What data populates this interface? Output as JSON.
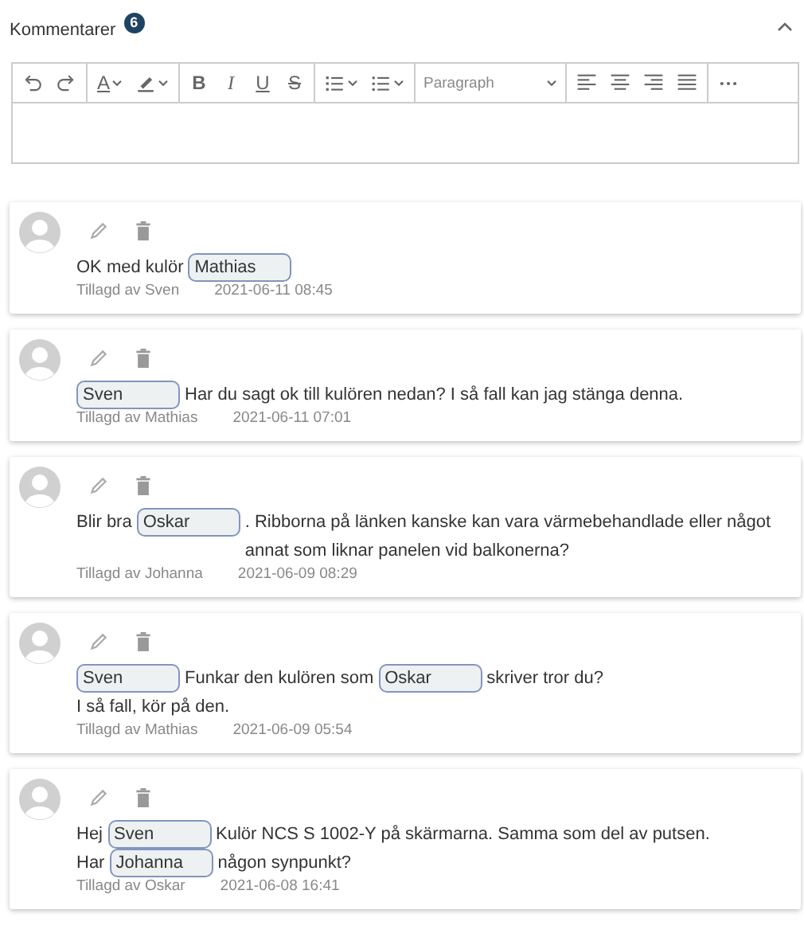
{
  "section": {
    "title": "Kommentarer",
    "count": "6",
    "expanded": true
  },
  "toolbar": {
    "groups": [
      [
        {
          "kind": "undo"
        },
        {
          "kind": "redo"
        }
      ],
      [
        {
          "kind": "font-color",
          "text": "A"
        },
        {
          "kind": "highlight"
        }
      ],
      [
        {
          "kind": "bold",
          "text": "B"
        },
        {
          "kind": "italic",
          "text": "I"
        },
        {
          "kind": "underline",
          "text": "U"
        },
        {
          "kind": "strike",
          "text": "S"
        }
      ],
      [
        {
          "kind": "ordered-list"
        },
        {
          "kind": "bullet-list"
        }
      ],
      [
        {
          "kind": "block-format",
          "text": "Paragraph"
        }
      ],
      [
        {
          "kind": "align-left"
        },
        {
          "kind": "align-center"
        },
        {
          "kind": "align-right"
        },
        {
          "kind": "align-justify"
        }
      ],
      [
        {
          "kind": "more"
        }
      ]
    ]
  },
  "comments": [
    {
      "author": "Tillagd av Sven",
      "date": "2021-06-11 08:45",
      "lines": [
        [
          {
            "kind": "text",
            "text": "OK med kulör"
          },
          {
            "kind": "mention",
            "text": "Mathias"
          }
        ]
      ]
    },
    {
      "author": "Tillagd av Mathias",
      "date": "2021-06-11 07:01",
      "lines": [
        [
          {
            "kind": "mention",
            "text": "Sven"
          },
          {
            "kind": "text",
            "text": "Har du sagt ok till kulören nedan? I så fall kan jag stänga denna."
          }
        ]
      ]
    },
    {
      "author": "Tillagd av Johanna",
      "date": "2021-06-09 08:29",
      "lines": [
        [
          {
            "kind": "text",
            "text": "Blir bra"
          },
          {
            "kind": "mention",
            "text": "Oskar"
          },
          {
            "kind": "text",
            "text": ". Ribborna på länken kanske kan vara värmebehandlade eller något annat som liknar panelen vid balkonerna?"
          }
        ]
      ]
    },
    {
      "author": "Tillagd av Mathias",
      "date": "2021-06-09 05:54",
      "lines": [
        [
          {
            "kind": "mention",
            "text": "Sven"
          },
          {
            "kind": "text",
            "text": "Funkar den kulören som"
          },
          {
            "kind": "mention",
            "text": "Oskar"
          },
          {
            "kind": "text",
            "text": "skriver tror du?"
          }
        ],
        [
          {
            "kind": "text",
            "text": "I så fall, kör på den."
          }
        ]
      ]
    },
    {
      "author": "Tillagd av Oskar",
      "date": "2021-06-08 16:41",
      "lines": [
        [
          {
            "kind": "text",
            "text": "Hej"
          },
          {
            "kind": "mention",
            "text": "Sven"
          },
          {
            "kind": "text",
            "text": "Kulör NCS S 1002-Y på skärmarna. Samma som del av putsen."
          }
        ],
        [
          {
            "kind": "text",
            "text": "Har"
          },
          {
            "kind": "mention",
            "text": "Johanna"
          },
          {
            "kind": "text",
            "text": "någon synpunkt?"
          }
        ]
      ]
    }
  ]
}
